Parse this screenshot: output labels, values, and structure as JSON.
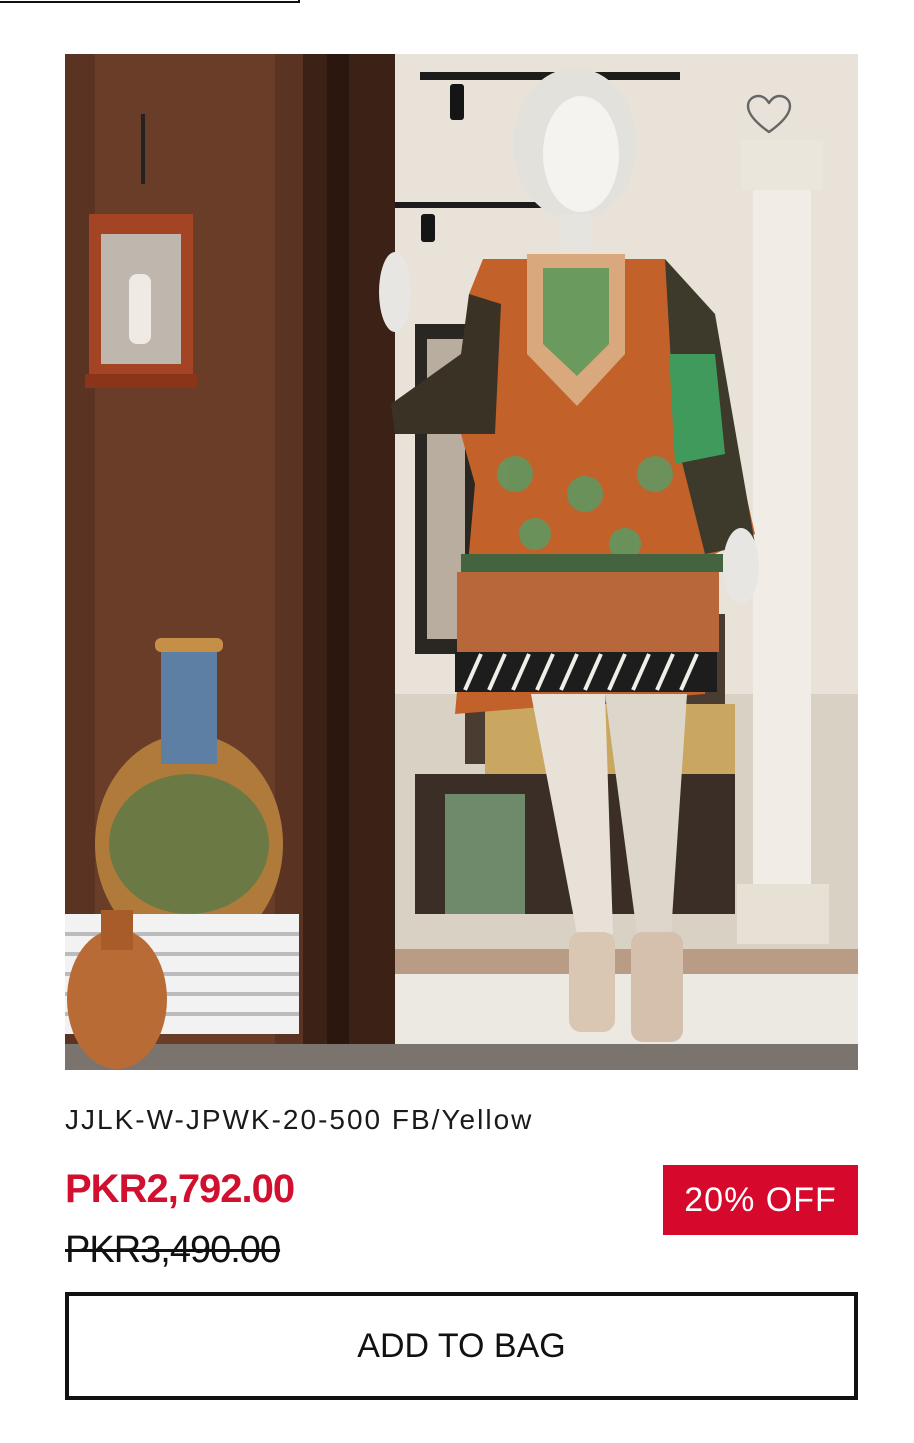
{
  "product": {
    "name": "JJLK-W-JPWK-20-500 FB/Yellow",
    "price_current": "PKR2,792.00",
    "price_original": "PKR3,490.00",
    "discount_badge": "20% OFF",
    "add_to_bag_label": "ADD TO BAG",
    "wishlist_icon": "heart-outline-icon"
  },
  "colors": {
    "sale_price": "#d0102e",
    "badge_background": "#d6082c",
    "button_border": "#111111"
  }
}
